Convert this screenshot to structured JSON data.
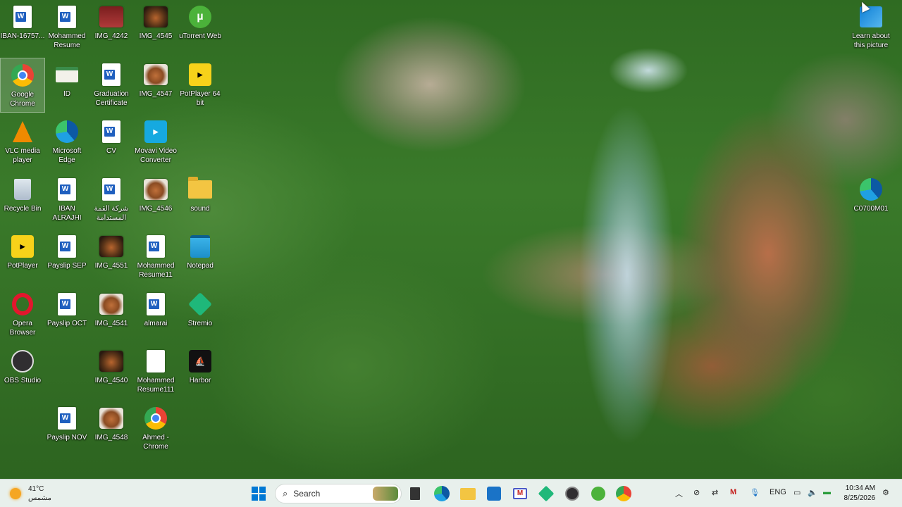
{
  "desktop": {
    "icons": [
      {
        "label": "IBAN-16757...",
        "kind": "doc"
      },
      {
        "label": "Mohammed Resume",
        "kind": "doc"
      },
      {
        "label": "IMG_4242",
        "kind": "photo-red"
      },
      {
        "label": "IMG_4545",
        "kind": "photo-dark"
      },
      {
        "label": "uTorrent Web",
        "kind": "utorrent"
      },
      {
        "label": "Google Chrome",
        "kind": "chrome"
      },
      {
        "label": "ID",
        "kind": "id-card"
      },
      {
        "label": "Graduation Certificate",
        "kind": "doc"
      },
      {
        "label": "IMG_4547",
        "kind": "photo"
      },
      {
        "label": "PotPlayer 64 bit",
        "kind": "potplayer"
      },
      {
        "label": "VLC media player",
        "kind": "vlc"
      },
      {
        "label": "Microsoft Edge",
        "kind": "edge"
      },
      {
        "label": "CV",
        "kind": "doc"
      },
      {
        "label": "Movavi Video Converter",
        "kind": "movavi"
      },
      {
        "label": "Recycle Bin",
        "kind": "recycle"
      },
      {
        "label": "IBAN ALRAJHI",
        "kind": "doc"
      },
      {
        "label": "شركة القمة المستدامة",
        "kind": "doc"
      },
      {
        "label": "IMG_4546",
        "kind": "photo"
      },
      {
        "label": "sound",
        "kind": "folder"
      },
      {
        "label": "PotPlayer",
        "kind": "potplayer"
      },
      {
        "label": "Payslip SEP",
        "kind": "doc"
      },
      {
        "label": "IMG_4551",
        "kind": "photo-dark"
      },
      {
        "label": "Mohammed Resume11",
        "kind": "doc"
      },
      {
        "label": "Notepad",
        "kind": "notepad"
      },
      {
        "label": "Opera Browser",
        "kind": "opera"
      },
      {
        "label": "Payslip OCT",
        "kind": "doc"
      },
      {
        "label": "IMG_4541",
        "kind": "photo"
      },
      {
        "label": "almarai",
        "kind": "doc"
      },
      {
        "label": "Stremio",
        "kind": "stremio"
      },
      {
        "label": "OBS Studio",
        "kind": "obs"
      },
      {
        "label": "IMG_4540",
        "kind": "photo-dark"
      },
      {
        "label": "Mohammed Resume111",
        "kind": "blank"
      },
      {
        "label": "Harbor",
        "kind": "harbor"
      },
      {
        "label": "Payslip NOV",
        "kind": "doc"
      },
      {
        "label": "IMG_4548",
        "kind": "photo"
      },
      {
        "label": "Ahmed - Chrome",
        "kind": "chrome"
      },
      {
        "label": "Learn about this picture",
        "kind": "spotlight"
      },
      {
        "label": "C0700M01",
        "kind": "edge"
      }
    ]
  },
  "taskbar": {
    "weather_temp": "41°C",
    "weather_desc": "مشمس",
    "search_label": "Search",
    "language": "ENG",
    "time": "10:34 AM",
    "date": "8/25/2026"
  },
  "colors": {
    "taskbar_bg": "#e8f0ec",
    "word_blue": "#1f5fbf",
    "windows_blue": "#0078d4"
  }
}
